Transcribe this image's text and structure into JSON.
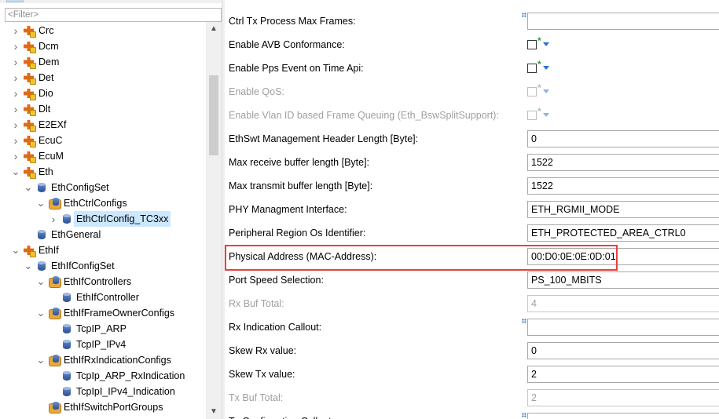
{
  "filter": {
    "placeholder": "<Filter>"
  },
  "tree": [
    {
      "label": "Crc",
      "icon": "module-icon",
      "level": 0,
      "expander": "collapsed"
    },
    {
      "label": "Dcm",
      "icon": "module-icon",
      "level": 0,
      "expander": "collapsed"
    },
    {
      "label": "Dem",
      "icon": "module-icon",
      "level": 0,
      "expander": "collapsed"
    },
    {
      "label": "Det",
      "icon": "module-icon",
      "level": 0,
      "expander": "collapsed"
    },
    {
      "label": "Dio",
      "icon": "module-icon",
      "level": 0,
      "expander": "collapsed"
    },
    {
      "label": "Dlt",
      "icon": "module-icon",
      "level": 0,
      "expander": "collapsed"
    },
    {
      "label": "E2EXf",
      "icon": "module-icon",
      "level": 0,
      "expander": "collapsed"
    },
    {
      "label": "EcuC",
      "icon": "module-icon",
      "level": 0,
      "expander": "collapsed"
    },
    {
      "label": "EcuM",
      "icon": "module-icon",
      "level": 0,
      "expander": "collapsed"
    },
    {
      "label": "Eth",
      "icon": "module-icon",
      "level": 0,
      "expander": "expanded"
    },
    {
      "label": "EthConfigSet",
      "icon": "container-icon",
      "level": 1,
      "expander": "expanded"
    },
    {
      "label": "EthCtrlConfigs",
      "icon": "collection-icon",
      "level": 2,
      "expander": "expanded"
    },
    {
      "label": "EthCtrlConfig_TC3xx",
      "icon": "container-icon",
      "level": 3,
      "expander": "collapsed",
      "selected": true
    },
    {
      "label": "EthGeneral",
      "icon": "container-icon",
      "level": 1,
      "expander": "none"
    },
    {
      "label": "EthIf",
      "icon": "module-icon",
      "level": 0,
      "expander": "expanded"
    },
    {
      "label": "EthIfConfigSet",
      "icon": "container-icon",
      "level": 1,
      "expander": "expanded"
    },
    {
      "label": "EthIfControllers",
      "icon": "collection-icon",
      "level": 2,
      "expander": "expanded"
    },
    {
      "label": "EthIfController",
      "icon": "container-icon",
      "level": 3,
      "expander": "none"
    },
    {
      "label": "EthIfFrameOwnerConfigs",
      "icon": "collection-icon",
      "level": 2,
      "expander": "expanded"
    },
    {
      "label": "TcpIP_ARP",
      "icon": "container-icon",
      "level": 3,
      "expander": "none"
    },
    {
      "label": "TcpIP_IPv4",
      "icon": "container-icon",
      "level": 3,
      "expander": "none"
    },
    {
      "label": "EthIfRxIndicationConfigs",
      "icon": "collection-icon",
      "level": 2,
      "expander": "expanded"
    },
    {
      "label": "TcpIp_ARP_RxIndication",
      "icon": "container-icon",
      "level": 3,
      "expander": "none"
    },
    {
      "label": "TcpIpI_IPv4_Indication",
      "icon": "container-icon",
      "level": 3,
      "expander": "none"
    },
    {
      "label": "EthIfSwitchPortGroups",
      "icon": "collection-icon",
      "level": 2,
      "expander": "none"
    }
  ],
  "properties": [
    {
      "label": "Ctrl Tx Process Max Frames:",
      "kind": "ref",
      "disabled": false
    },
    {
      "label": "Enable AVB Conformance:",
      "kind": "checkbox",
      "disabled": false
    },
    {
      "label": "Enable Pps Event on Time Api:",
      "kind": "checkbox",
      "disabled": false
    },
    {
      "label": "Enable QoS:",
      "kind": "checkbox",
      "disabled": true
    },
    {
      "label": "Enable Vlan ID based Frame Queuing (Eth_BswSplitSupport):",
      "kind": "checkbox",
      "disabled": true
    },
    {
      "label": "EthSwt Management Header Length [Byte]:",
      "kind": "text",
      "value": "0",
      "disabled": false
    },
    {
      "label": "Max receive buffer length [Byte]:",
      "kind": "text",
      "value": "1522",
      "disabled": false
    },
    {
      "label": "Max transmit buffer length [Byte]:",
      "kind": "text",
      "value": "1522",
      "disabled": false
    },
    {
      "label": "PHY Managment Interface:",
      "kind": "text",
      "value": "ETH_RGMII_MODE",
      "disabled": false
    },
    {
      "label": "Peripheral Region Os Identifier:",
      "kind": "text",
      "value": "ETH_PROTECTED_AREA_CTRL0",
      "disabled": false
    },
    {
      "label": "Physical Address (MAC-Address):",
      "kind": "text",
      "value": "00:D0:0E:0E:0D:01",
      "disabled": false,
      "highlighted": true
    },
    {
      "label": "Port Speed Selection:",
      "kind": "text",
      "value": "PS_100_MBITS",
      "disabled": false
    },
    {
      "label": "Rx Buf Total:",
      "kind": "text",
      "value": "4",
      "disabled": true
    },
    {
      "label": "Rx Indication Callout:",
      "kind": "ref",
      "value": "",
      "disabled": false
    },
    {
      "label": "Skew Rx value:",
      "kind": "text",
      "value": "0",
      "disabled": false
    },
    {
      "label": "Skew Tx value:",
      "kind": "text",
      "value": "2",
      "disabled": false
    },
    {
      "label": "Tx Buf Total:",
      "kind": "text",
      "value": "2",
      "disabled": true
    },
    {
      "label": "Tx Confirmation Callout:",
      "kind": "ref",
      "value": "",
      "disabled": false
    }
  ],
  "colors": {
    "selection": "#cce8ff",
    "highlight_border": "#e8413a",
    "disabled_text": "#a0a0a0"
  }
}
